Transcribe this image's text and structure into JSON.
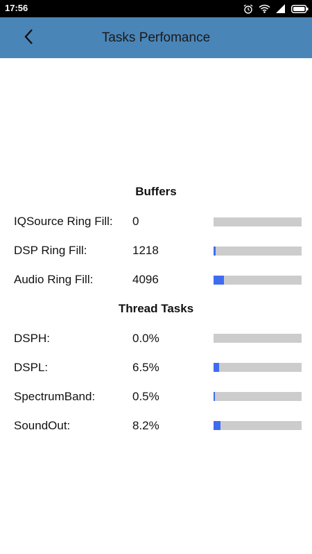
{
  "status_bar": {
    "time": "17:56",
    "icons": [
      "alarm-icon",
      "wifi-icon",
      "signal-icon",
      "battery-icon"
    ]
  },
  "app_bar": {
    "title": "Tasks Perfomance",
    "back_icon": "chevron-left-icon",
    "background_color": "#4a85b8"
  },
  "accent_color": "#3e6cf0",
  "track_color": "#cccccc",
  "buffers": {
    "header": "Buffers",
    "rows": [
      {
        "label": "IQSource Ring Fill:",
        "value": "0",
        "fill": 0.0
      },
      {
        "label": "DSP Ring Fill:",
        "value": "1218",
        "fill": 0.02
      },
      {
        "label": "Audio Ring Fill:",
        "value": "4096",
        "fill": 0.12
      }
    ]
  },
  "thread_tasks": {
    "header": "Thread Tasks",
    "rows": [
      {
        "label": "DSPH:",
        "value": "0.0%",
        "fill": 0.0
      },
      {
        "label": "DSPL:",
        "value": "6.5%",
        "fill": 0.065
      },
      {
        "label": "SpectrumBand:",
        "value": "0.5%",
        "fill": 0.005
      },
      {
        "label": "SoundOut:",
        "value": "8.2%",
        "fill": 0.082
      }
    ]
  }
}
